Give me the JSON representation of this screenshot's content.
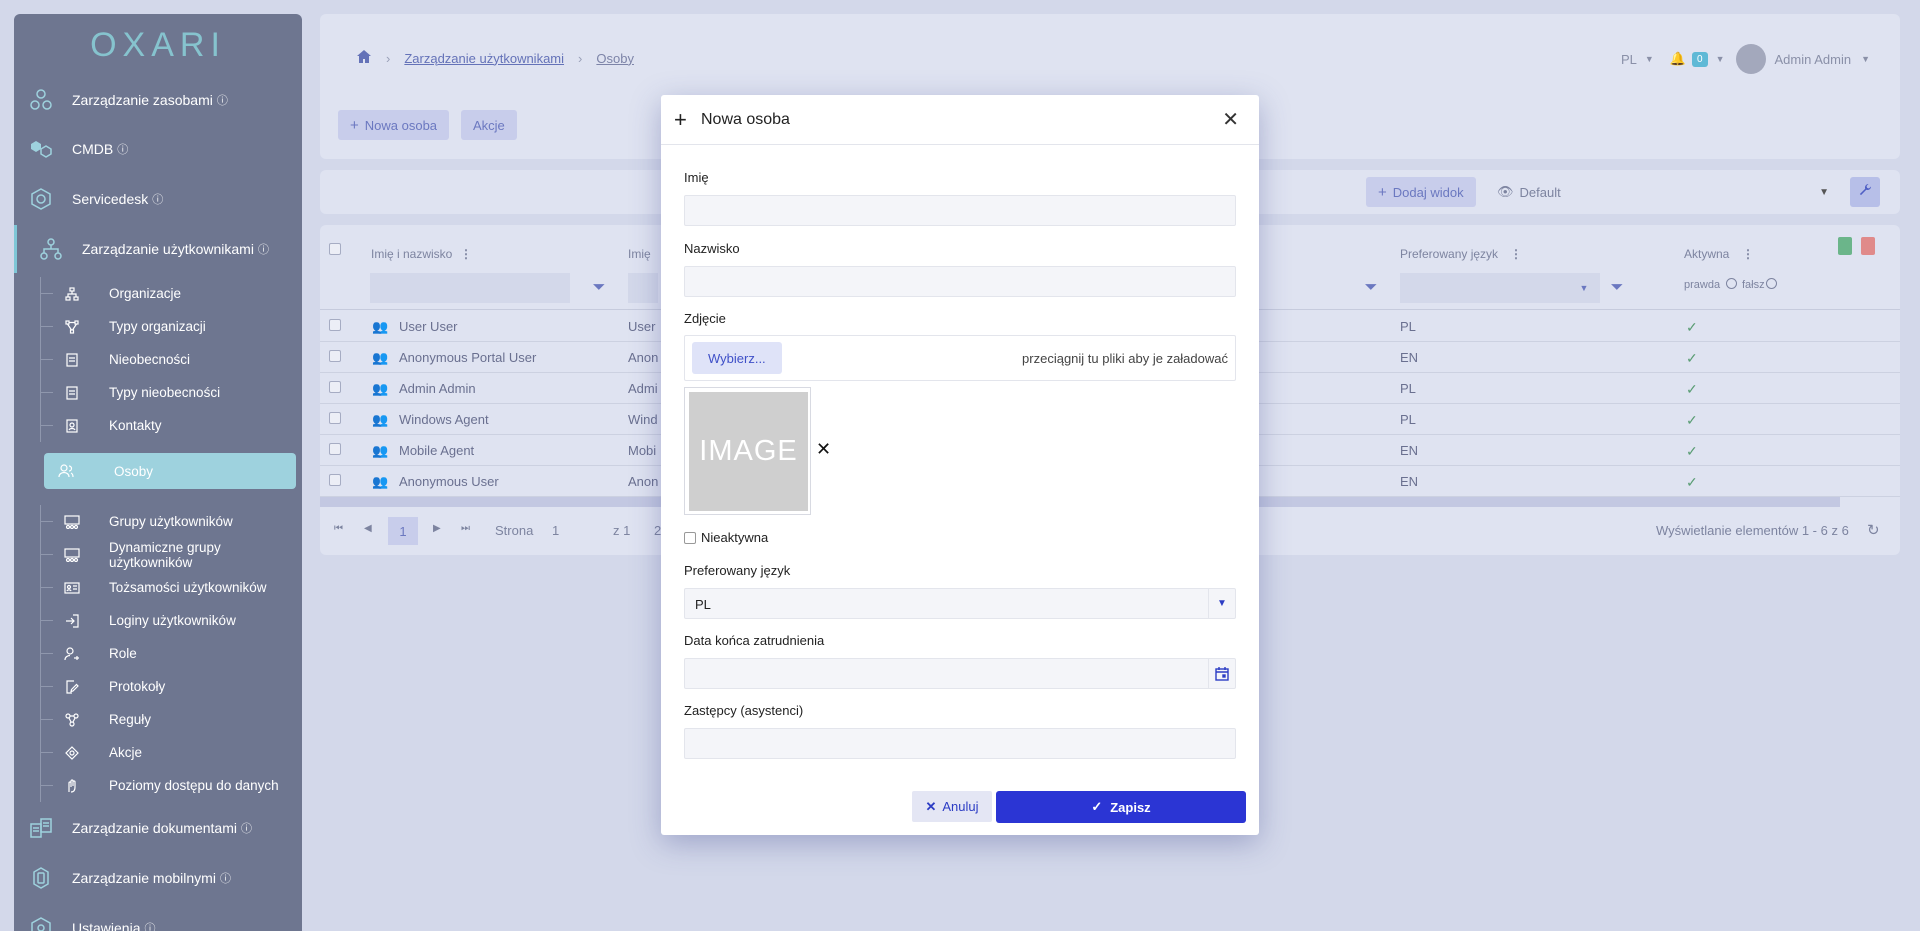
{
  "sidebar": {
    "logo": "OXARI",
    "main_items": [
      {
        "label": "Zarządzanie zasobami"
      },
      {
        "label": "CMDB"
      },
      {
        "label": "Servicedesk"
      },
      {
        "label": "Zarządzanie użytkownikami"
      },
      {
        "label": "Zarządzanie dokumentami"
      },
      {
        "label": "Zarządzanie mobilnymi"
      },
      {
        "label": "Ustawienia"
      }
    ],
    "sub_items": [
      {
        "label": "Organizacje"
      },
      {
        "label": "Typy organizacji"
      },
      {
        "label": "Nieobecności"
      },
      {
        "label": "Typy nieobecności"
      },
      {
        "label": "Kontakty"
      },
      {
        "label": "Osoby"
      },
      {
        "label": "Grupy użytkowników"
      },
      {
        "label": "Dynamiczne grupy użytkowników"
      },
      {
        "label": "Tożsamości użytkowników"
      },
      {
        "label": "Loginy użytkowników"
      },
      {
        "label": "Role"
      },
      {
        "label": "Protokoły"
      },
      {
        "label": "Reguły"
      },
      {
        "label": "Akcje"
      },
      {
        "label": "Poziomy dostępu do danych"
      }
    ]
  },
  "breadcrumb": {
    "section": "Zarządzanie użytkownikami",
    "current": "Osoby"
  },
  "topright": {
    "lang": "PL",
    "notifications": "0",
    "user": "Admin Admin"
  },
  "actions": {
    "new_person": "Nowa osoba",
    "actions": "Akcje"
  },
  "viewbar": {
    "add_view": "Dodaj widok",
    "view": "Default"
  },
  "grid": {
    "columns": {
      "name": "Imię i nazwisko",
      "first": "Imię",
      "lang": "Preferowany język",
      "active": "Aktywna"
    },
    "active_filter": {
      "yes": "prawda",
      "no": "fałsz"
    },
    "rows": [
      {
        "name": "User User",
        "first": "User",
        "lang": "PL"
      },
      {
        "name": "Anonymous Portal User",
        "first": "Anon",
        "lang": "EN"
      },
      {
        "name": "Admin Admin",
        "first": "Admi",
        "lang": "PL"
      },
      {
        "name": "Windows Agent",
        "first": "Wind",
        "lang": "PL"
      },
      {
        "name": "Mobile Agent",
        "first": "Mobi",
        "lang": "EN"
      },
      {
        "name": "Anonymous User",
        "first": "Anon",
        "lang": "EN"
      }
    ],
    "pager": {
      "page_label": "Strona",
      "page": "1",
      "of": "z 1",
      "size": "2",
      "summary": "Wyświetlanie elementów 1 - 6 z 6"
    }
  },
  "modal": {
    "title": "Nowa osoba",
    "first_name_label": "Imię",
    "last_name_label": "Nazwisko",
    "photo_label": "Zdjęcie",
    "choose_button": "Wybierz...",
    "drop_hint": "przeciągnij tu pliki aby je załadować",
    "image_placeholder": "IMAGE",
    "inactive_label": "Nieaktywna",
    "lang_label": "Preferowany język",
    "lang_value": "PL",
    "end_date_label": "Data końca zatrudnienia",
    "deputies_label": "Zastępcy (asystenci)",
    "cancel": "Anuluj",
    "save": "Zapisz"
  }
}
